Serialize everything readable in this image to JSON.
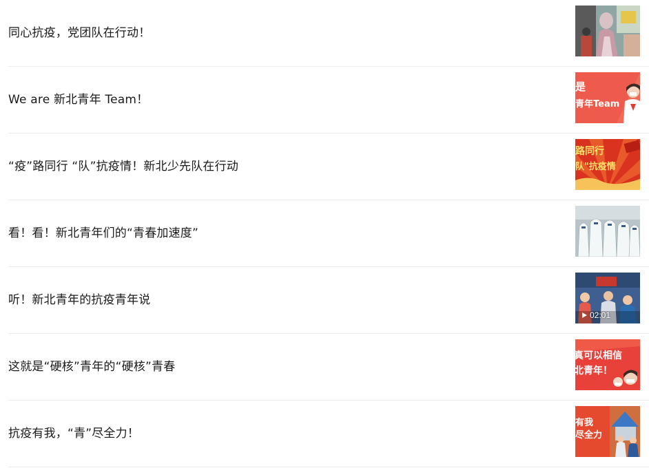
{
  "articles": [
    {
      "title": "同心抗疫，党团队在行动！",
      "thumb": "crowd-photo"
    },
    {
      "title": "We are 新北青年 Team！",
      "thumb": "poster",
      "thumb_text": [
        "是",
        "青年Team"
      ]
    },
    {
      "title": "“疫”路同行 “队”抗疫情！新北少先队在行动",
      "thumb": "poster",
      "thumb_text": [
        "路同行",
        "队\"抗疫情"
      ]
    },
    {
      "title": "看！看！新北青年们的“青春加速度”",
      "thumb": "medical-team-photo"
    },
    {
      "title": "听！新北青年的抗疫青年说",
      "thumb": "video",
      "duration": "02:01"
    },
    {
      "title": "这就是“硬核”青年的“硬核”青春",
      "thumb": "poster",
      "thumb_text": [
        "真可以相信",
        "北青年！"
      ]
    },
    {
      "title": "抗疫有我，“青”尽全力！",
      "thumb": "poster",
      "thumb_text": [
        "有我",
        "尽全力"
      ]
    }
  ],
  "colors": {
    "title_text": "#1a1a1a",
    "divider": "#ececec",
    "poster_red": "#e8413a"
  }
}
